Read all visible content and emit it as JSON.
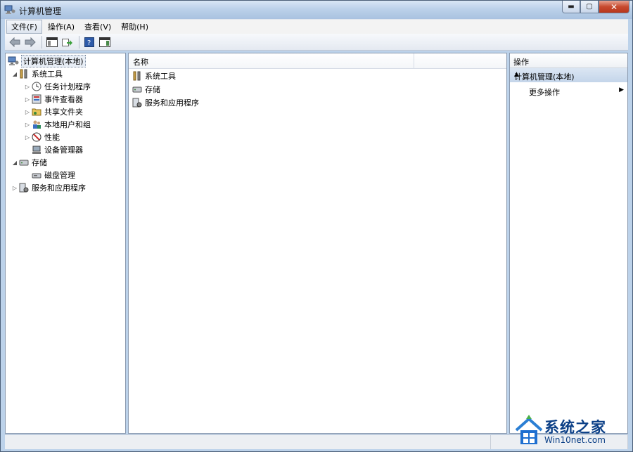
{
  "window": {
    "title": "计算机管理"
  },
  "menu": [
    {
      "label": "文件(F)",
      "active": true
    },
    {
      "label": "操作(A)"
    },
    {
      "label": "查看(V)"
    },
    {
      "label": "帮助(H)"
    }
  ],
  "tree": {
    "root": "计算机管理(本地)",
    "system_tools": "系统工具",
    "task_scheduler": "任务计划程序",
    "event_viewer": "事件查看器",
    "shared_folders": "共享文件夹",
    "local_users": "本地用户和组",
    "performance": "性能",
    "device_manager": "设备管理器",
    "storage": "存储",
    "disk_management": "磁盘管理",
    "services_apps": "服务和应用程序"
  },
  "list": {
    "column_name": "名称",
    "items": [
      "系统工具",
      "存储",
      "服务和应用程序"
    ]
  },
  "actions": {
    "header": "操作",
    "section": "计算机管理(本地)",
    "more": "更多操作"
  },
  "watermark": {
    "brand": "系统之家",
    "site": "Win10net.com"
  },
  "colors": {
    "accent": "#0b3f86",
    "selection": "#c4d5ea",
    "close": "#c74a2e"
  }
}
